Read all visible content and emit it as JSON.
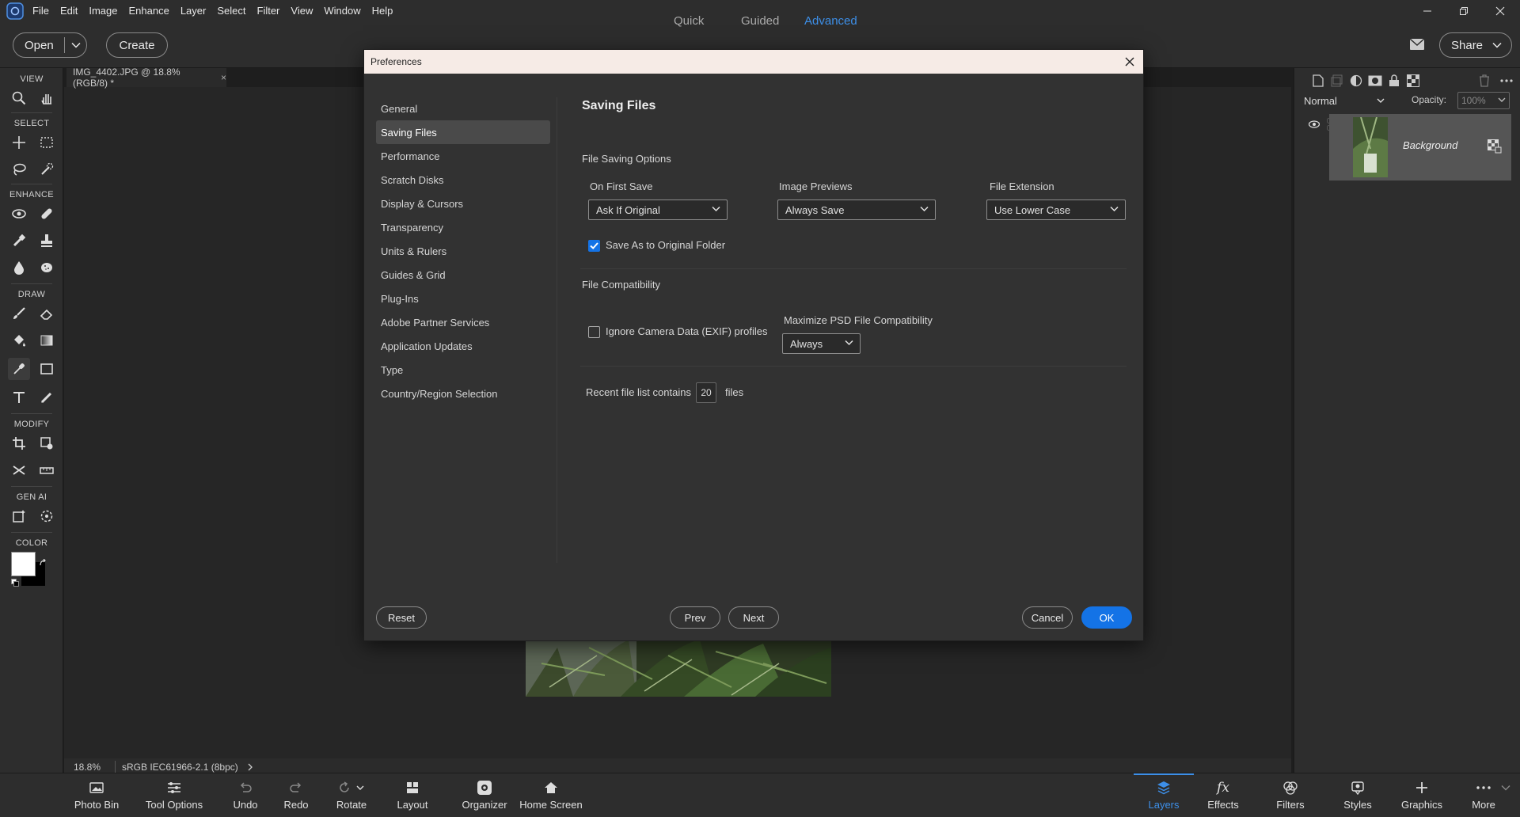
{
  "menubar": {
    "items": [
      "File",
      "Edit",
      "Image",
      "Enhance",
      "Layer",
      "Select",
      "Filter",
      "View",
      "Window",
      "Help"
    ]
  },
  "modebar": {
    "open_label": "Open",
    "create_label": "Create",
    "modes": [
      "Quick",
      "Guided",
      "Advanced"
    ],
    "active_mode": "Advanced",
    "share_label": "Share"
  },
  "toolbox": {
    "sections": [
      "VIEW",
      "SELECT",
      "ENHANCE",
      "DRAW",
      "MODIFY",
      "GEN AI",
      "COLOR"
    ]
  },
  "document": {
    "tab_title": "IMG_4402.JPG @ 18.8% (RGB/8) *",
    "zoom": "18.8%",
    "color_profile": "sRGB IEC61966-2.1 (8bpc)"
  },
  "layers_panel": {
    "blend_mode": "Normal",
    "opacity_label": "Opacity:",
    "opacity_value": "100%",
    "layer_name": "Background"
  },
  "bottombar": {
    "left": [
      "Photo Bin",
      "Tool Options",
      "Undo",
      "Redo",
      "Rotate",
      "Layout",
      "Organizer",
      "Home Screen"
    ],
    "right": [
      "Layers",
      "Effects",
      "Filters",
      "Styles",
      "Graphics",
      "More"
    ],
    "active": "Layers"
  },
  "dialog": {
    "title": "Preferences",
    "nav": [
      "General",
      "Saving Files",
      "Performance",
      "Scratch Disks",
      "Display & Cursors",
      "Transparency",
      "Units & Rulers",
      "Guides & Grid",
      "Plug-Ins",
      "Adobe Partner Services",
      "Application Updates",
      "Type",
      "Country/Region Selection"
    ],
    "selected_nav": "Saving Files",
    "heading": "Saving Files",
    "file_saving_options": {
      "label": "File Saving Options",
      "on_first_save_label": "On First Save",
      "on_first_save_value": "Ask If Original",
      "image_previews_label": "Image Previews",
      "image_previews_value": "Always Save",
      "file_extension_label": "File Extension",
      "file_extension_value": "Use Lower Case",
      "save_as_original_label": "Save As to Original Folder",
      "save_as_original_checked": true
    },
    "file_compatibility": {
      "label": "File Compatibility",
      "ignore_camera_label": "Ignore Camera Data (EXIF) profiles",
      "ignore_camera_checked": false,
      "maximize_psd_label": "Maximize PSD File Compatibility",
      "maximize_psd_value": "Always"
    },
    "recent_files": {
      "prefix": "Recent file list contains",
      "value": "20",
      "suffix": "files"
    },
    "buttons": {
      "reset": "Reset",
      "prev": "Prev",
      "next": "Next",
      "cancel": "Cancel",
      "ok": "OK"
    }
  },
  "colors": {
    "accent": "#1473e6",
    "active_mode": "#3d8fe8",
    "dialog_title_bg": "#f6ebe6"
  }
}
